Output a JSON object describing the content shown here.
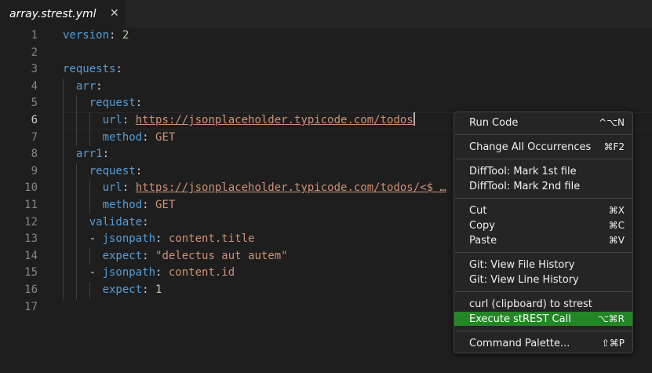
{
  "tab": {
    "title": "array.strest.yml",
    "close": "✕"
  },
  "editor": {
    "lines": [
      {
        "num": "1",
        "tokens": [
          [
            "k",
            "version"
          ],
          [
            "p",
            ": "
          ],
          [
            "n",
            "2"
          ]
        ]
      },
      {
        "num": "2",
        "tokens": []
      },
      {
        "num": "3",
        "tokens": [
          [
            "k",
            "requests"
          ],
          [
            "p",
            ":"
          ]
        ]
      },
      {
        "num": "4",
        "tokens": [
          [
            "k",
            "arr"
          ],
          [
            "p",
            ":"
          ]
        ]
      },
      {
        "num": "5",
        "tokens": [
          [
            "k",
            "request"
          ],
          [
            "p",
            ":"
          ]
        ]
      },
      {
        "num": "6",
        "tokens": [
          [
            "k",
            "url"
          ],
          [
            "p",
            ": "
          ],
          [
            "u",
            "https://jsonplaceholder.typicode.com/todos"
          ]
        ]
      },
      {
        "num": "7",
        "tokens": [
          [
            "k",
            "method"
          ],
          [
            "p",
            ": "
          ],
          [
            "s",
            "GET"
          ]
        ]
      },
      {
        "num": "8",
        "tokens": [
          [
            "k",
            "arr1"
          ],
          [
            "p",
            ":"
          ]
        ]
      },
      {
        "num": "9",
        "tokens": [
          [
            "k",
            "request"
          ],
          [
            "p",
            ":"
          ]
        ]
      },
      {
        "num": "10",
        "tokens": [
          [
            "k",
            "url"
          ],
          [
            "p",
            ": "
          ],
          [
            "u",
            "https://jsonplaceholder.typicode.com/todos/<$ …"
          ]
        ]
      },
      {
        "num": "11",
        "tokens": [
          [
            "k",
            "method"
          ],
          [
            "p",
            ": "
          ],
          [
            "s",
            "GET"
          ]
        ]
      },
      {
        "num": "12",
        "tokens": [
          [
            "k",
            "validate"
          ],
          [
            "p",
            ":"
          ]
        ]
      },
      {
        "num": "13",
        "tokens": [
          [
            "p",
            "- "
          ],
          [
            "k",
            "jsonpath"
          ],
          [
            "p",
            ": "
          ],
          [
            "s",
            "content.title"
          ]
        ]
      },
      {
        "num": "14",
        "tokens": [
          [
            "k",
            "expect"
          ],
          [
            "p",
            ": "
          ],
          [
            "s",
            "\"delectus aut autem\""
          ]
        ]
      },
      {
        "num": "15",
        "tokens": [
          [
            "p",
            "- "
          ],
          [
            "k",
            "jsonpath"
          ],
          [
            "p",
            ": "
          ],
          [
            "s",
            "content.id"
          ]
        ]
      },
      {
        "num": "16",
        "tokens": [
          [
            "k",
            "expect"
          ],
          [
            "p",
            ": "
          ],
          [
            "n",
            "1"
          ]
        ]
      },
      {
        "num": "17",
        "tokens": []
      }
    ]
  },
  "context_menu": {
    "items": [
      {
        "label": "Run Code",
        "shortcut": "^⌥N"
      },
      {
        "label": "Change All Occurrences",
        "shortcut": "⌘F2"
      },
      {
        "label": "DiffTool: Mark 1st file",
        "shortcut": ""
      },
      {
        "label": "DiffTool: Mark 2nd file",
        "shortcut": ""
      },
      {
        "label": "Cut",
        "shortcut": "⌘X"
      },
      {
        "label": "Copy",
        "shortcut": "⌘C"
      },
      {
        "label": "Paste",
        "shortcut": "⌘V"
      },
      {
        "label": "Git: View File History",
        "shortcut": ""
      },
      {
        "label": "Git: View Line History",
        "shortcut": ""
      },
      {
        "label": "curl (clipboard) to strest",
        "shortcut": ""
      },
      {
        "label": "Execute stREST Call",
        "shortcut": "⌥⌘R",
        "highlighted": true
      },
      {
        "label": "Command Palette...",
        "shortcut": "⇧⌘P"
      }
    ]
  },
  "colors": {
    "highlight": "#248526",
    "keyword": "#569cd6",
    "string": "#ce9178",
    "number": "#b5cea8"
  }
}
